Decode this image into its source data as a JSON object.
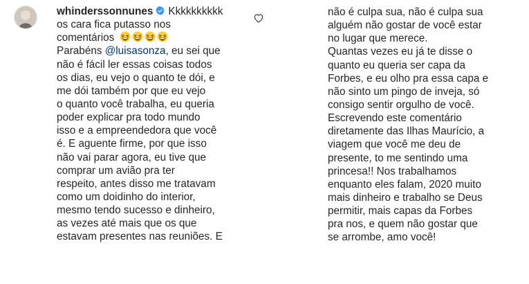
{
  "comment": {
    "username": "whinderssonnunes",
    "mention": "@luisasonza",
    "left_lines": [
      "Kkkkkkkkkk",
      "os cara fica putasso nos",
      "comentários",
      "Parabéns",
      ", eu sei que",
      "não é fácil ler essas coisas todos",
      "os dias, eu vejo o quanto te dói, e",
      "me dói também por que eu vejo",
      "o quanto você trabalha, eu queria",
      "poder explicar pra todo mundo",
      "isso e a empreendedora que você",
      "é. E aguente firme, por que isso",
      "não vai parar agora, eu tive que",
      "comprar um avião pra ter",
      "respeito, antes disso me tratavam",
      "como um doidinho do interior,",
      "mesmo tendo sucesso e dinheiro,",
      "as vezes até mais que os que",
      "estavam presentes nas reuniões. E"
    ],
    "right_lines": [
      "não é culpa sua, não é culpa sua",
      "alguém não gostar de você estar",
      "no lugar que merece.",
      "Quantas vezes eu já te disse o",
      "quanto eu queria ser capa da",
      "Forbes, e eu olho pra essa capa e",
      "não sinto um pingo de inveja, só",
      "consigo sentir orgulho de você.",
      "Escrevendo este comentário",
      "diretamente das Ilhas Maurício, a",
      "viagem que você me deu de",
      "presente, to me sentindo uma",
      "princesa!! Nos trabalhamos",
      "enquanto eles falam, 2020 muito",
      "mais dinheiro e trabalho se Deus",
      "permitir, mais capas da Forbes",
      "pra nos, e quem não gostar que",
      "se arrombe, amo você!"
    ],
    "emoji_name": "grinning-squinting-face-emoji",
    "icons": {
      "verified": "verified-badge-icon",
      "like": "heart-icon"
    }
  },
  "colors": {
    "text": "#262626",
    "mention": "#00376b",
    "verified": "#3897f0",
    "emoji": "#ffcc33"
  }
}
